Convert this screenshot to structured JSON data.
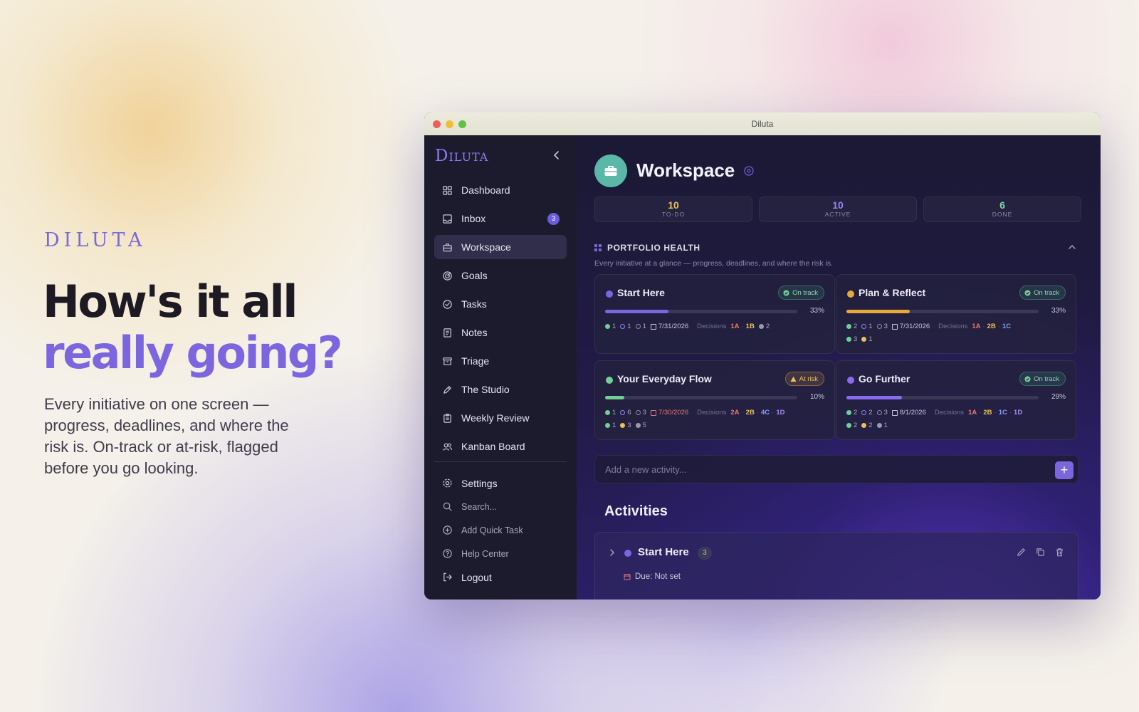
{
  "hero": {
    "logo": "DILUTA",
    "headline_line1": "How's it all",
    "headline_line2": "really going?",
    "body": "Every initiative on one screen — progress, deadlines, and where the risk is. On-track or at-risk, flagged before you go looking."
  },
  "window": {
    "title": "Diluta"
  },
  "sidebar": {
    "brand": "Diluta",
    "items": [
      {
        "label": "Dashboard",
        "icon": "grid-icon"
      },
      {
        "label": "Inbox",
        "icon": "inbox-icon",
        "badge": "3"
      },
      {
        "label": "Workspace",
        "icon": "briefcase-icon",
        "active": true
      },
      {
        "label": "Goals",
        "icon": "target-icon"
      },
      {
        "label": "Tasks",
        "icon": "check-circle-icon"
      },
      {
        "label": "Notes",
        "icon": "note-icon"
      },
      {
        "label": "Triage",
        "icon": "archive-icon"
      },
      {
        "label": "The Studio",
        "icon": "pen-icon"
      },
      {
        "label": "Weekly Review",
        "icon": "clipboard-icon"
      },
      {
        "label": "Kanban Board",
        "icon": "users-icon"
      }
    ],
    "bottom": {
      "settings": "Settings",
      "search": "Search...",
      "quick_task": "Add Quick Task",
      "help": "Help Center",
      "logout": "Logout"
    }
  },
  "workspace": {
    "title": "Workspace",
    "stats": [
      {
        "value": "10",
        "label": "TO-DO",
        "color": "#e8c15a"
      },
      {
        "value": "10",
        "label": "ACTIVE",
        "color": "#8f86f0"
      },
      {
        "value": "6",
        "label": "DONE",
        "color": "#7fd3a8"
      }
    ],
    "portfolio": {
      "heading": "PORTFOLIO HEALTH",
      "subtitle": "Every initiative at a glance — progress, deadlines, and where the risk is.",
      "decisions_label": "Decisions",
      "cards": [
        {
          "title": "Start Here",
          "dot": "#7b66e0",
          "status": "On track",
          "progress": 0.33,
          "pct": "33%",
          "bar": "#7b66e0",
          "done": "1",
          "active": "1",
          "todo": "1",
          "date": "7/31/2026",
          "date_color": "#c9c7dc",
          "decisions": [
            "1A",
            "1B"
          ],
          "extra": "2",
          "row2": []
        },
        {
          "title": "Plan & Reflect",
          "dot": "#e8a93a",
          "status": "On track",
          "progress": 0.33,
          "pct": "33%",
          "bar": "#e8a93a",
          "done": "2",
          "active": "1",
          "todo": "3",
          "date": "7/31/2026",
          "date_color": "#c9c7dc",
          "decisions": [
            "1A",
            "2B",
            "1C"
          ],
          "extra": "",
          "row2": [
            "3",
            "1"
          ]
        },
        {
          "title": "Your Everyday Flow",
          "dot": "#6fcf97",
          "status": "At risk",
          "progress": 0.1,
          "pct": "10%",
          "bar": "#6fcf97",
          "done": "1",
          "active": "6",
          "todo": "3",
          "date": "7/30/2026",
          "date_color": "#e07a7a",
          "decisions": [
            "2A",
            "2B",
            "4C",
            "1D"
          ],
          "extra": "",
          "row2": [
            "1",
            "3",
            "5"
          ]
        },
        {
          "title": "Go Further",
          "dot": "#8a6cf0",
          "status": "On track",
          "progress": 0.29,
          "pct": "29%",
          "bar": "#8a6cf0",
          "done": "2",
          "active": "2",
          "todo": "3",
          "date": "8/1/2026",
          "date_color": "#c9c7dc",
          "decisions": [
            "1A",
            "2B",
            "1C",
            "1D"
          ],
          "extra": "",
          "row2": [
            "2",
            "2",
            "1"
          ]
        }
      ]
    },
    "add_placeholder": "Add a new activity...",
    "add_button": "+",
    "activities_heading": "Activities",
    "activity": {
      "title": "Start Here",
      "count": "3",
      "due": "Due: Not set"
    }
  },
  "colors": {
    "decA": "#e87a6a",
    "decB": "#e8c15a",
    "decC": "#7fa0f0",
    "decD": "#a98cf5",
    "green": "#6fcf97",
    "yellow": "#e8c15a",
    "gray": "#9a98b0"
  }
}
